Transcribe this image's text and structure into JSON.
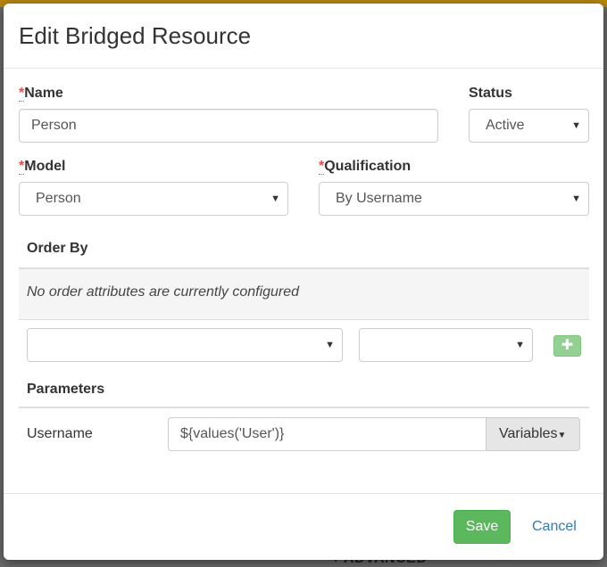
{
  "background": {
    "hint_text": "▾ ADVANCED"
  },
  "dialog": {
    "title": "Edit Bridged Resource",
    "required_marker": "*",
    "name": {
      "label": "Name",
      "value": "Person"
    },
    "status": {
      "label": "Status",
      "value": "Active"
    },
    "model": {
      "label": "Model",
      "value": "Person"
    },
    "qualification": {
      "label": "Qualification",
      "value": "By Username"
    },
    "order_by": {
      "heading": "Order By",
      "empty_message": "No order attributes are currently configured",
      "attribute_select": "",
      "direction_select": "",
      "add_icon": "plus-icon"
    },
    "parameters": {
      "heading": "Parameters",
      "rows": [
        {
          "name": "Username",
          "value": "${values('User')}"
        }
      ],
      "variables_label": "Variables"
    },
    "footer": {
      "save_label": "Save",
      "cancel_label": "Cancel"
    }
  },
  "colors": {
    "save": "#5cb85c",
    "add_button": "#92d192",
    "required": "#d9534f",
    "link": "#337ab7"
  }
}
